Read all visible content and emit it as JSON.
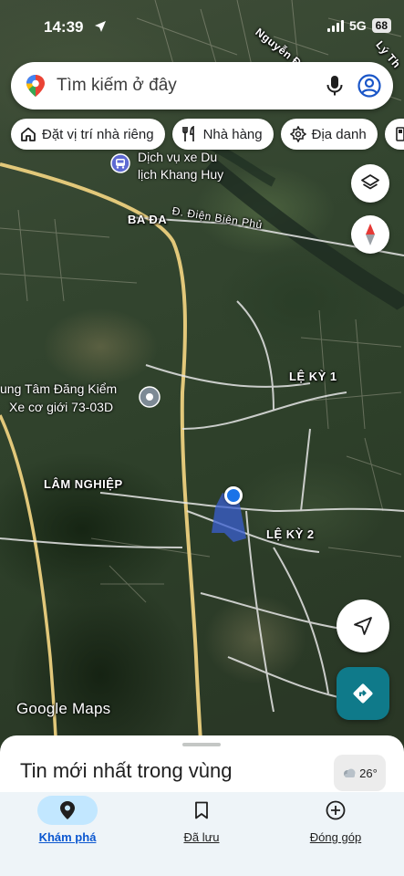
{
  "status_bar": {
    "time": "14:39",
    "network": "5G",
    "battery": "68"
  },
  "search": {
    "placeholder": "Tìm kiếm ở đây"
  },
  "chips": [
    {
      "label": "Đặt vị trí nhà riêng",
      "icon": "home-icon"
    },
    {
      "label": "Nhà hàng",
      "icon": "restaurant-icon"
    },
    {
      "label": "Địa danh",
      "icon": "landmark-icon"
    }
  ],
  "map": {
    "labels": {
      "top_street": "Nguyễn Đoá",
      "ly_th": "Lý Th",
      "ba_da": "BA ĐA",
      "dien_bien_phu": "Đ. Điện Biên Phủ",
      "le_ky_1": "LỆ KỲ 1",
      "le_ky_2": "LỆ KỲ 2",
      "lam_nghiep": "LÂM NGHIỆP"
    },
    "poi": {
      "bus_name_line1": "Dịch vụ xe Du",
      "bus_name_line2": "lịch Khang Huy",
      "center_line1": "ung Tâm Đăng Kiểm",
      "center_line2": "Xe cơ giới 73-03D"
    },
    "attribution": "Google Maps"
  },
  "sheet": {
    "title": "Tin mới nhất trong vùng",
    "weather": "26°"
  },
  "nav": [
    {
      "label": "Khám phá",
      "icon": "explore-pin-icon",
      "active": true
    },
    {
      "label": "Đã lưu",
      "icon": "bookmark-icon",
      "active": false
    },
    {
      "label": "Đóng góp",
      "icon": "add-circle-icon",
      "active": false
    }
  ],
  "colors": {
    "accent": "#0b57d0",
    "nav_active_bg": "#c2e7ff",
    "directions_bg": "#0f7a8a",
    "location_dot": "#1a73e8"
  }
}
